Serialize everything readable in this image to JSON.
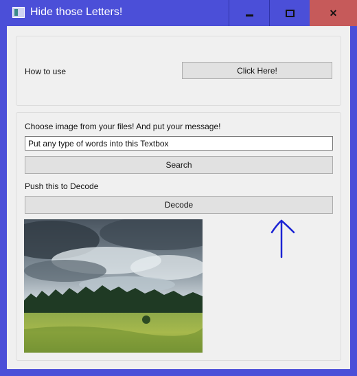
{
  "window": {
    "title": "Hide those Letters!",
    "icon": "app-window-icon",
    "controls": {
      "minimize": "minimize-icon",
      "maximize": "maximize-icon",
      "close": "✕"
    }
  },
  "help_section": {
    "label": "How to use",
    "button_label": "Click Here!"
  },
  "encode_section": {
    "instruction": "Choose image from your files! And put your message!",
    "textbox_value": "Put any type of words into this Textbox",
    "search_label": "Search",
    "decode_instruction": "Push this to Decode",
    "decode_label": "Decode"
  },
  "image_preview": {
    "subject": "cloudy sky over forest and meadow"
  },
  "annotation": {
    "arrow_color": "#1c24d4",
    "arrow_icon": "hand-drawn-up-arrow-icon"
  },
  "colors": {
    "titlebar": "#4b4fd8",
    "close_button": "#c65a5a",
    "client": "#f0f0f0"
  }
}
